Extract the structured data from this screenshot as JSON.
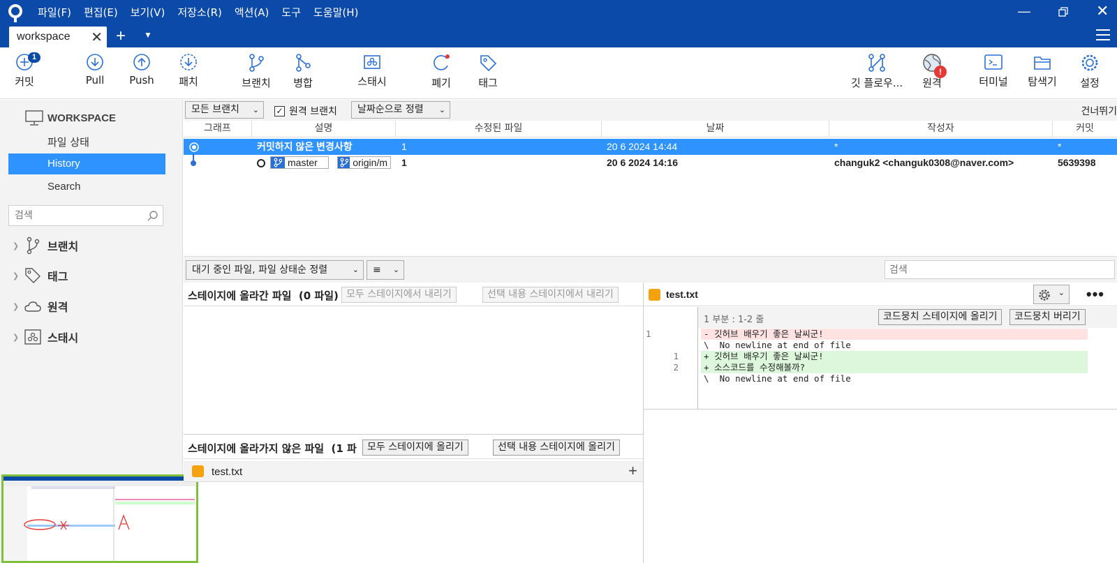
{
  "titlebar": {
    "menu": [
      "파일(F)",
      "편집(E)",
      "보기(V)",
      "저장소(R)",
      "액션(A)",
      "도구",
      "도움말(H)"
    ],
    "tab_label": "workspace"
  },
  "toolbar": {
    "commit": "커밋",
    "commit_badge": "1",
    "pull": "Pull",
    "push": "Push",
    "patch": "패치",
    "branch": "브랜치",
    "merge": "병합",
    "stash": "스태시",
    "discard": "폐기",
    "tag": "태그",
    "git_flow": "깃 플로우...",
    "remote": "원격",
    "remote_badge": "!",
    "terminal": "터미널",
    "explorer": "탐색기",
    "settings": "설정"
  },
  "sidebar": {
    "workspace_title": "WORKSPACE",
    "items": [
      "파일 상태",
      "History",
      "Search"
    ],
    "search_placeholder": "검색",
    "groups": [
      "브랜치",
      "태그",
      "원격",
      "스태시"
    ]
  },
  "filterbar": {
    "branches_dropdown": "모든 브랜치",
    "remote_branch_label": "원격 브랜치",
    "sort_dropdown": "날짜순으로 정렬",
    "skip": "건너뛰기"
  },
  "table": {
    "headers": [
      "그래프",
      "설명",
      "수정된 파일",
      "날짜",
      "작성자",
      "커밋"
    ],
    "uncommitted": {
      "desc": "커밋하지 않은 변경사항",
      "files": "1",
      "date": "20 6 2024 14:44",
      "author": "*",
      "commit": "*"
    },
    "commit_row": {
      "branch_local": "master",
      "branch_remote": "origin/m",
      "files": "1",
      "date": "20 6 2024 14:16",
      "author": "changuk2 <changuk0308@naver.com>",
      "commit": "5639398"
    }
  },
  "pending": {
    "sort_dropdown": "대기 중인 파일, 파일 상태순 정렬",
    "search_placeholder": "검색"
  },
  "staged": {
    "title": "스테이지에 올라간 파일",
    "count": "(0 파일)",
    "unstage_all": "모두 스테이지에서 내리기",
    "unstage_selected": "선택 내용 스테이지에서 내리기"
  },
  "unstaged": {
    "title": "스테이지에 올라가지 않은 파일",
    "count": "(1 파",
    "stage_all": "모두 스테이지에 올리기",
    "stage_selected": "선택 내용 스테이지에 올리기",
    "file_name": "test.txt"
  },
  "diff": {
    "file_name": "test.txt",
    "hunk_label": "1 부분 : 1-2 줄",
    "stage_hunk": "코드뭉치 스테이지에 올리기",
    "discard_hunk": "코드뭉치 버리기",
    "lines": [
      {
        "type": "del",
        "old": "1",
        "new": "",
        "text": "- 깃허브 배우기 좋은 날씨군!"
      },
      {
        "type": "ctx",
        "old": "",
        "new": "",
        "text": "\\  No newline at end of file"
      },
      {
        "type": "add",
        "old": "",
        "new": "1",
        "text": "+ 깃허브 배우기 좋은 날씨군!"
      },
      {
        "type": "add",
        "old": "",
        "new": "2",
        "text": "+ 소스코드를 수정해볼까?"
      },
      {
        "type": "ctx",
        "old": "",
        "new": "",
        "text": "\\  No newline at end of file"
      }
    ]
  },
  "colors": {
    "brand_blue": "#0b4aa8",
    "selection_blue": "#2f93ff",
    "deleted_bg": "#ffe3e3",
    "added_bg": "#ddf7dd",
    "modified_file": "#f4a20d"
  }
}
